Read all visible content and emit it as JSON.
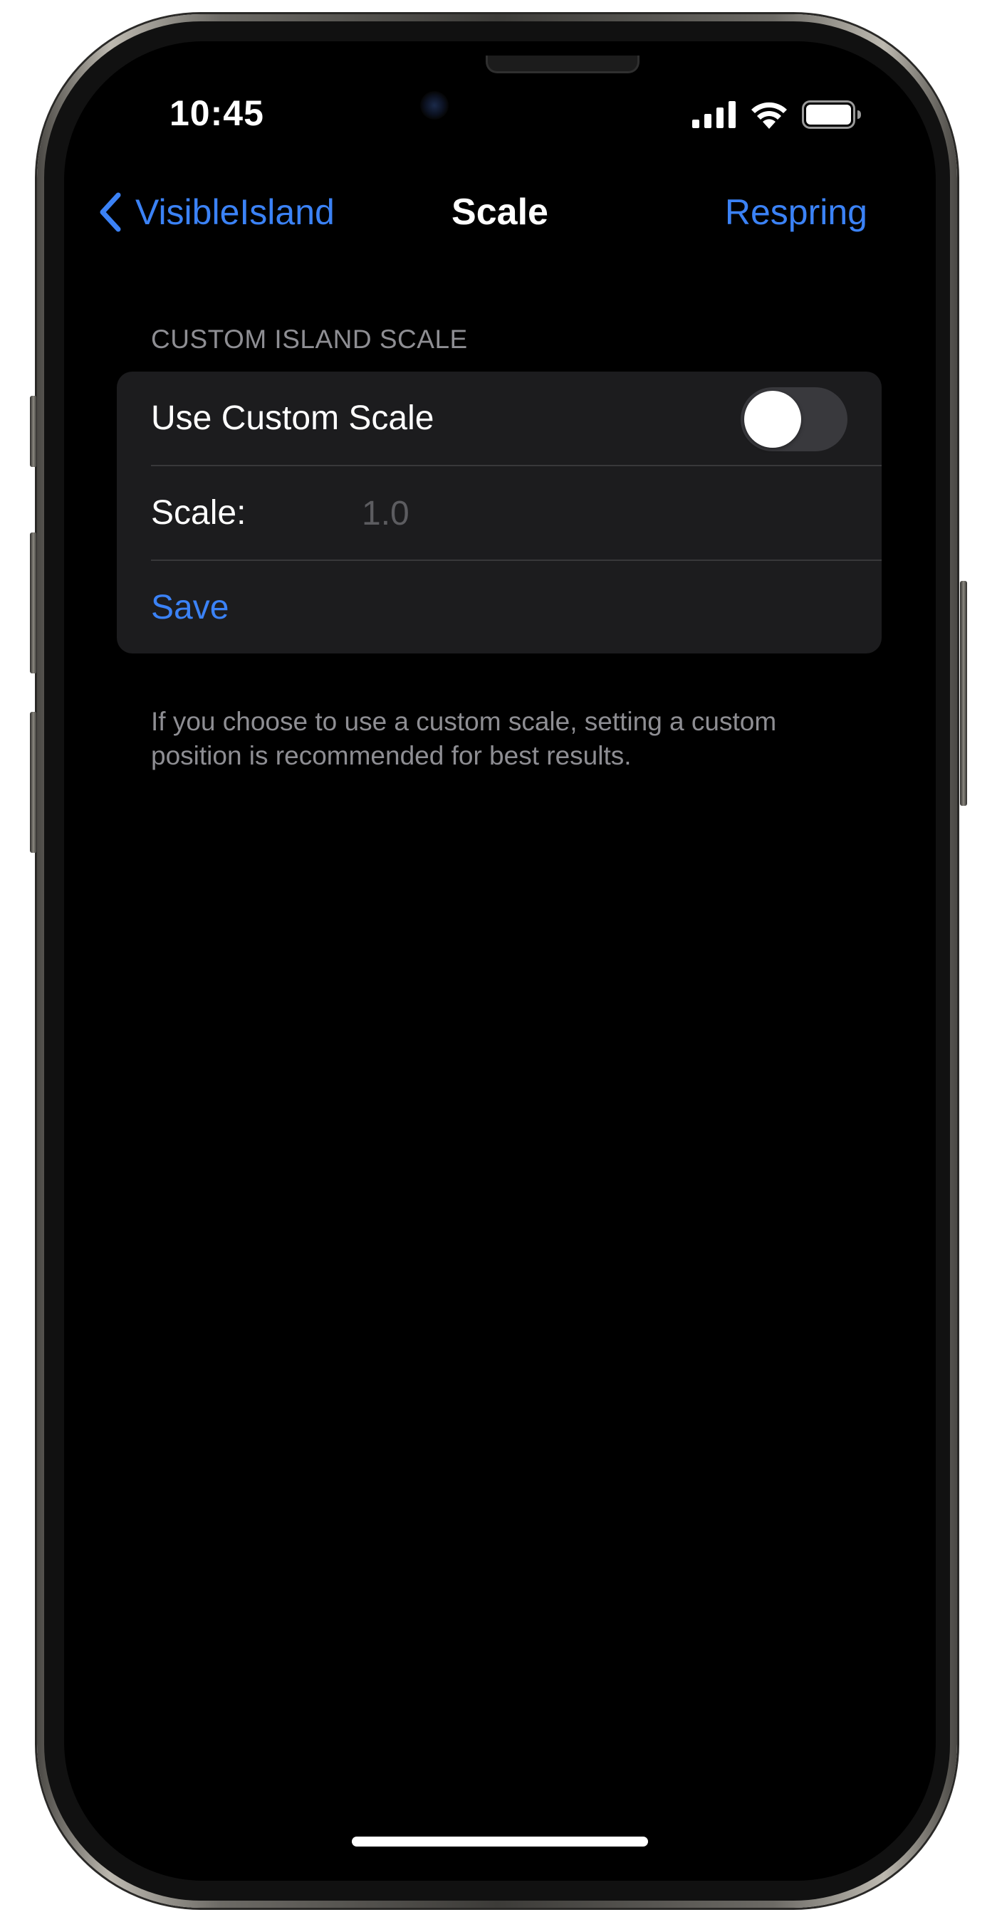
{
  "status_bar": {
    "time": "10:45",
    "icons": [
      "cellular-signal-icon",
      "wifi-icon",
      "battery-icon"
    ]
  },
  "nav": {
    "back_label": "VisibleIsland",
    "title": "Scale",
    "action_label": "Respring"
  },
  "section": {
    "header": "CUSTOM ISLAND SCALE",
    "use_custom_scale": {
      "label": "Use Custom Scale",
      "enabled": false
    },
    "scale": {
      "label": "Scale:",
      "value": "",
      "placeholder": "1.0"
    },
    "save_label": "Save",
    "footer": "If you choose to use a custom scale, setting a custom position is recommended for best results."
  },
  "colors": {
    "accent": "#3b82f6",
    "background": "#000000",
    "group_background": "#1c1c1e",
    "secondary_text": "#8e8e93",
    "toggle_off": "#39393d"
  }
}
